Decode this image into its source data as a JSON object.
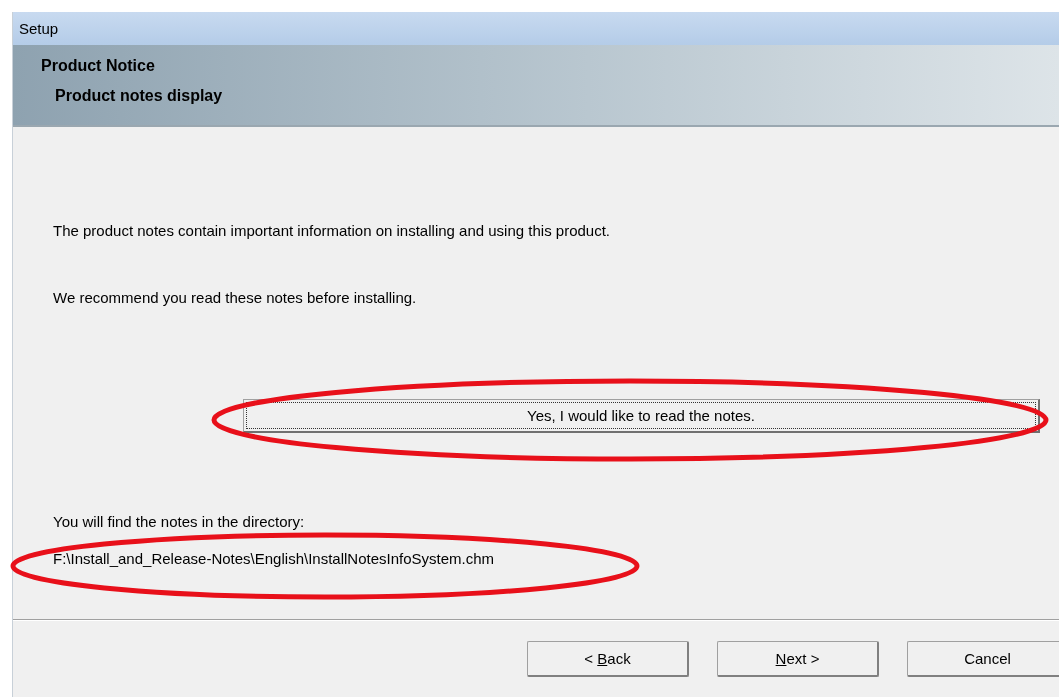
{
  "window": {
    "title": "Setup"
  },
  "banner": {
    "title": "Product Notice",
    "subtitle": "Product notes display"
  },
  "paragraphs": [
    "The product notes contain important information on installing and using this product.",
    "We recommend you read these notes before installing."
  ],
  "read_button": {
    "label": "Yes, I would like to read the notes.",
    "focused": true
  },
  "directory_label": "You will find the notes in the directory:",
  "directory_path": "F:\\Install_and_Release-Notes\\English\\InstallNotesInfoSystem.chm",
  "buttons": [
    {
      "before": "< ",
      "key": "B",
      "after": "ack"
    },
    {
      "key": "N",
      "after": "ext >"
    },
    {
      "before": "Cancel"
    }
  ]
}
